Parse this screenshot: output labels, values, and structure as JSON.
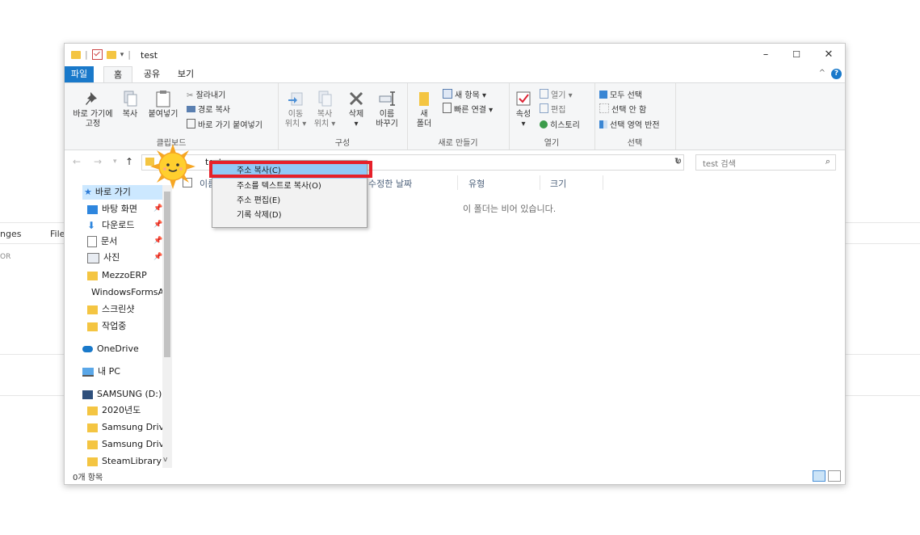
{
  "background": {
    "left_text_1": "nges",
    "left_text_2": "File",
    "left_text_3": "OR"
  },
  "window": {
    "title": "test",
    "title_sep": "|",
    "qat_arrow": "▾",
    "controls": {
      "minimize": "–",
      "maximize": "☐",
      "close": "✕"
    }
  },
  "tabs": [
    {
      "label": "파일"
    },
    {
      "label": "홈"
    },
    {
      "label": "공유"
    },
    {
      "label": "보기"
    }
  ],
  "ribbon": {
    "collapse_chevron": "^",
    "help": "?",
    "clipboard": {
      "pin_quick": [
        "바로 가기에",
        "고정"
      ],
      "copy": "복사",
      "paste": "붙여넣기",
      "cut": "잘라내기",
      "copy_path": "경로 복사",
      "paste_shortcut": "바로 가기 붙여넣기",
      "group_label": "클립보드"
    },
    "organize": {
      "move_to": [
        "이동",
        "위치 ▾"
      ],
      "copy_to": [
        "복사",
        "위치 ▾"
      ],
      "delete": [
        "삭제",
        "▾"
      ],
      "rename": [
        "이름",
        "바꾸기"
      ],
      "group_label": "구성"
    },
    "new": {
      "new_folder": [
        "새",
        "폴더"
      ],
      "new_item": "새 항목 ▾",
      "easy_access": "빠른 연결 ▾",
      "group_label": "새로 만들기"
    },
    "open": {
      "properties": [
        "속성",
        "▾"
      ],
      "open": "열기 ▾",
      "edit": "편집",
      "history": "히스토리",
      "group_label": "열기"
    },
    "select": {
      "select_all": "모두 선택",
      "select_none": "선택 안 함",
      "invert": "선택 영역 반전",
      "group_label": "선택"
    }
  },
  "address": {
    "path": "test",
    "back": "←",
    "forward": "→",
    "recent": "▾",
    "up": "↑",
    "dropdown": "v",
    "refresh": "↻",
    "search_placeholder": "test 검색",
    "search_icon": "⌕"
  },
  "nav_pane": {
    "items": [
      {
        "label": "바로 가기",
        "pin": ""
      },
      {
        "label": "바탕 화면",
        "pin": "📌"
      },
      {
        "label": "다운로드",
        "pin": "📌"
      },
      {
        "label": "문서",
        "pin": "📌"
      },
      {
        "label": "사진",
        "pin": "📌"
      },
      {
        "label": "MezzoERP",
        "pin": ""
      },
      {
        "label": "WindowsFormsA",
        "pin": ""
      },
      {
        "label": "스크린샷",
        "pin": ""
      },
      {
        "label": "작업중",
        "pin": ""
      },
      {
        "label": "OneDrive",
        "pin": ""
      },
      {
        "label": "내 PC",
        "pin": ""
      },
      {
        "label": "SAMSUNG (D:)",
        "pin": ""
      },
      {
        "label": "2020년도",
        "pin": ""
      },
      {
        "label": "Samsung Drive",
        "pin": ""
      },
      {
        "label": "Samsung Drive",
        "pin": ""
      },
      {
        "label": "SteamLibrary",
        "pin": ""
      }
    ],
    "scroll_down": "v"
  },
  "columns": {
    "name": "이름",
    "modified": "수정한 날짜",
    "type": "유형",
    "size": "크기"
  },
  "empty_message": "이 폴더는 비어 있습니다.",
  "status": {
    "count": "0개 항목"
  },
  "context_menu": {
    "items": [
      {
        "label": "주소 복사(C)"
      },
      {
        "label": "주소를 텍스트로 복사(O)"
      },
      {
        "label": "주소 편집(E)"
      },
      {
        "label": "기록 삭제(D)"
      }
    ]
  },
  "colors": {
    "accent": "#1979ca",
    "highlight": "#91c9f7",
    "annotation": "#e6202a",
    "folder": "#f4c542"
  }
}
